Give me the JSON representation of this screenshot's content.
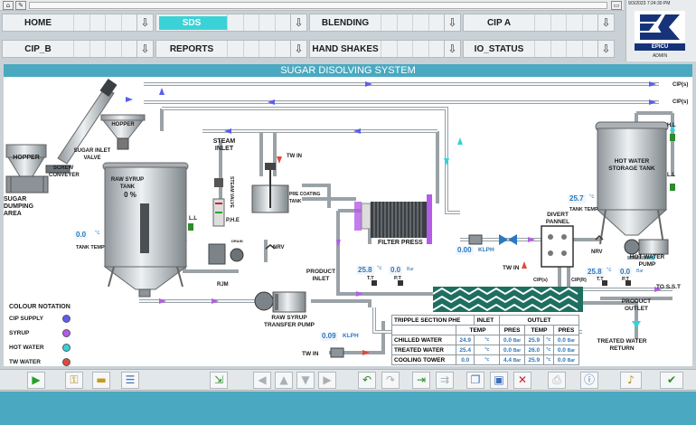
{
  "header": {
    "datetime": "9/3/2023 7:24:30 PM",
    "user": "ADMIN",
    "brand": "EPICU"
  },
  "nav": [
    {
      "label": "HOME",
      "active": false
    },
    {
      "label": "SDS",
      "active": true
    },
    {
      "label": "BLENDING",
      "active": false
    },
    {
      "label": "CIP A",
      "active": false
    },
    {
      "label": "CIP_B",
      "active": false
    },
    {
      "label": "REPORTS",
      "active": false
    },
    {
      "label": "HAND SHAKES",
      "active": false
    },
    {
      "label": "IO_STATUS",
      "active": false
    }
  ],
  "title": "SUGAR DISOLVING SYSTEM",
  "labels": {
    "hopper_left": "HOPPER",
    "hopper_top": "HOPPER",
    "sugar_dumping": "SUGAR DUMPING\nAREA",
    "screw_conveyer": "SCREW\nCONVEYER",
    "sugar_inlet_valve": "SUGAR INLET\nVALVE",
    "raw_syrup_tank": "RAW SYRUP\nTANK",
    "steam_inlet": "STEAM\nINLET",
    "steam_valve": "STEAM VALVE",
    "phe": "P.H.E",
    "drain": "DRAIN",
    "rjm": "RJM",
    "ll_raw": "L.L",
    "tank_temp": "TANK TEMP",
    "tw_in_top": "TW IN",
    "pre_coating": "PRE COATING\nTANK",
    "nrv_mid": "NRV",
    "filter_press": "FILTER PRESS",
    "product_inlet": "PRODUCT\nINLET",
    "transfer_pump": "RAW SYRUP\nTRANSFER PUMP",
    "tw_in_bottom": "TW IN",
    "divert_pannel": "DIVERT\nPANNEL",
    "tw_in_right": "TW IN",
    "cip_s": "CIP(s)",
    "cip_r": "CIP(R)",
    "hot_water_tank": "HOT WATER\nSTORAGE TANK",
    "hl": "H.L",
    "ll_hot": "L.L",
    "tank_temp_right": "TANK TEMP",
    "nrv_right": "NRV",
    "hot_water_pump": "HOT WATER\nPUMP",
    "to_sst": "TO S.S.T",
    "product_outlet": "PRODUCT\nOUTLET",
    "treated_water_return": "TREATED WATER\nRETURN",
    "cip_s_top1": "CIP(s)",
    "cip_s_top2": "CIP(s)",
    "tt1": "T.T",
    "pt1": "P.T",
    "tt2": "T.T",
    "pt2": "P.T"
  },
  "values": {
    "raw_tank_level": "0",
    "raw_tank_level_unit": "%",
    "raw_tank_temp": "0.0",
    "raw_tank_temp_unit": "°c",
    "hot_tank_temp": "25.7",
    "hot_tank_temp_unit": "°c",
    "inlet_temp": "25.8",
    "inlet_temp_unit": "°c",
    "inlet_pres": "0.0",
    "inlet_pres_unit": "Bar",
    "outlet_temp": "25.8",
    "outlet_temp_unit": "°c",
    "outlet_pres": "0.0",
    "outlet_pres_unit": "Bar",
    "flow_top": "0.00",
    "flow_top_unit": "KLPH",
    "flow_bottom": "0.09",
    "flow_bottom_unit": "KLPH"
  },
  "legend": {
    "title": "COLOUR NOTATION",
    "items": [
      {
        "label": "CIP SUPPLY",
        "color": "#5b5ef0"
      },
      {
        "label": "SYRUP",
        "color": "#b45ce8"
      },
      {
        "label": "HOT WATER",
        "color": "#36d2dc"
      },
      {
        "label": "TW WATER",
        "color": "#e0493f"
      }
    ]
  },
  "phe_table": {
    "title": "TRIPPLE SECTION PHE",
    "inlet": "INLET",
    "outlet": "OUTLET",
    "col_temp": "TEMP",
    "col_pres": "PRES",
    "rows": [
      {
        "name": "CHILLED WATER",
        "in_temp": "24.9",
        "in_pres": "0.0",
        "out_temp": "25.9",
        "out_pres": "0.0"
      },
      {
        "name": "TREATED WATER",
        "in_temp": "25.4",
        "in_pres": "0.0",
        "out_temp": "26.0",
        "out_pres": "0.0"
      },
      {
        "name": "COOLING TOWER",
        "in_temp": "0.0",
        "in_pres": "4.4",
        "out_temp": "25.9",
        "out_pres": "0.0"
      }
    ],
    "temp_unit": "°c",
    "pres_unit": "Bar"
  },
  "toolbar_icons": [
    "play-icon",
    "key-icon",
    "folder-icon",
    "document-icon",
    "import-icon",
    "arrow-left-icon",
    "arrow-up-icon",
    "arrow-down-icon",
    "arrow-right-icon",
    "undo-icon",
    "redo-icon",
    "forward-icon",
    "skip-icon",
    "copy-icon",
    "save-icon",
    "delete-icon",
    "print-icon",
    "info-icon",
    "sound-icon",
    "check-icon"
  ]
}
